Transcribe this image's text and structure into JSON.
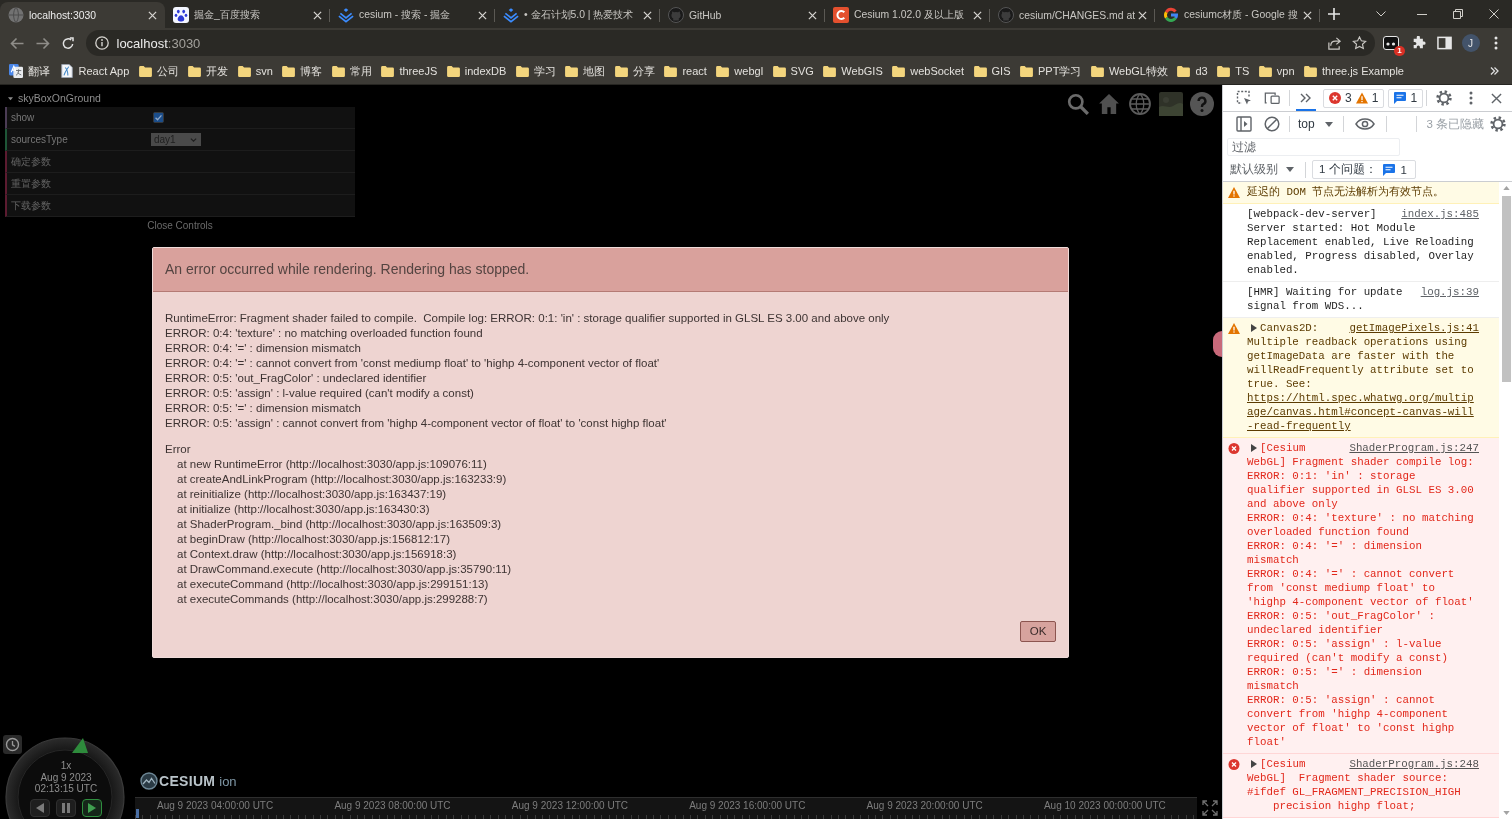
{
  "browser": {
    "tabs": [
      {
        "title": "localhost:3030",
        "kind": "globe",
        "selected": true
      },
      {
        "title": "掘金_百度搜索",
        "kind": "paw",
        "selected": false
      },
      {
        "title": "cesium - 搜索 - 掘金",
        "kind": "chevrons",
        "selected": false
      },
      {
        "title": "• 金石计划5.0 | 热爱技术",
        "kind": "chevrons",
        "selected": false
      },
      {
        "title": "GitHub",
        "kind": "octo",
        "selected": false
      },
      {
        "title": "Cesium 1.02.0 及以上版",
        "kind": "tile",
        "selected": false
      },
      {
        "title": "cesium/CHANGES.md at",
        "kind": "octo",
        "selected": false
      },
      {
        "title": "cesiumc材质 - Google 搜",
        "kind": "ring",
        "selected": false
      }
    ],
    "navigation": {
      "back": {
        "disabled": true
      },
      "forward": {
        "disabled": true
      }
    },
    "address": {
      "host": "localhost",
      "rest": ":3030"
    },
    "extension_badge": "1",
    "profile_initial": "J",
    "bookmarks": [
      {
        "label": "翻译",
        "kind": "translate"
      },
      {
        "label": "React App",
        "kind": "page"
      },
      {
        "label": "公司",
        "kind": "folder"
      },
      {
        "label": "开发",
        "kind": "folder"
      },
      {
        "label": "svn",
        "kind": "folder"
      },
      {
        "label": "博客",
        "kind": "folder"
      },
      {
        "label": "常用",
        "kind": "folder"
      },
      {
        "label": "threeJS",
        "kind": "folder"
      },
      {
        "label": "indexDB",
        "kind": "folder"
      },
      {
        "label": "学习",
        "kind": "folder"
      },
      {
        "label": "地图",
        "kind": "folder"
      },
      {
        "label": "分享",
        "kind": "folder"
      },
      {
        "label": "react",
        "kind": "folder"
      },
      {
        "label": "webgl",
        "kind": "folder"
      },
      {
        "label": "SVG",
        "kind": "folder"
      },
      {
        "label": "WebGIS",
        "kind": "folder"
      },
      {
        "label": "webSocket",
        "kind": "folder"
      },
      {
        "label": "GIS",
        "kind": "folder"
      },
      {
        "label": "PPT学习",
        "kind": "folder"
      },
      {
        "label": "WebGL特效",
        "kind": "folder"
      },
      {
        "label": "d3",
        "kind": "folder"
      },
      {
        "label": "TS",
        "kind": "folder"
      },
      {
        "label": "vpn",
        "kind": "folder"
      },
      {
        "label": "three.js Example",
        "kind": "folder"
      }
    ]
  },
  "viewer": {
    "gui": {
      "title": "skyBoxOnGround",
      "expanded": true,
      "rows": [
        {
          "kind": "boolean",
          "label": "show",
          "checked": true
        },
        {
          "kind": "select",
          "label": "sourcesType",
          "value": "day1"
        },
        {
          "kind": "function",
          "label": "确定参数"
        },
        {
          "kind": "function",
          "label": "重置参数"
        },
        {
          "kind": "function",
          "label": "下载参数"
        }
      ],
      "close_label": "Close Controls"
    },
    "error_dialog": {
      "title": "An error occurred while rendering. Rendering has stopped.",
      "message_lines": [
        "RuntimeError: Fragment shader failed to compile.  Compile log: ERROR: 0:1: 'in' : storage qualifier supported in GLSL ES 3.00 and above only",
        "ERROR: 0:4: 'texture' : no matching overloaded function found",
        "ERROR: 0:4: '=' : dimension mismatch",
        "ERROR: 0:4: '=' : cannot convert from 'const mediump float' to 'highp 4-component vector of float'",
        "ERROR: 0:5: 'out_FragColor' : undeclared identifier",
        "ERROR: 0:5: 'assign' : l-value required (can't modify a const)",
        "ERROR: 0:5: '=' : dimension mismatch",
        "ERROR: 0:5: 'assign' : cannot convert from 'highp 4-component vector of float' to 'const highp float'"
      ],
      "stack_title": "Error",
      "stack_lines": [
        "at new RuntimeError (http://localhost:3030/app.js:109076:11)",
        "at createAndLinkProgram (http://localhost:3030/app.js:163233:9)",
        "at reinitialize (http://localhost:3030/app.js:163437:19)",
        "at initialize (http://localhost:3030/app.js:163430:3)",
        "at ShaderProgram._bind (http://localhost:3030/app.js:163509:3)",
        "at beginDraw (http://localhost:3030/app.js:156812:17)",
        "at Context.draw (http://localhost:3030/app.js:156918:3)",
        "at DrawCommand.execute (http://localhost:3030/app.js:35790:11)",
        "at executeCommand (http://localhost:3030/app.js:299151:13)",
        "at executeCommands (http://localhost:3030/app.js:299288:7)"
      ],
      "button": "OK"
    },
    "clock": {
      "speed": "1x",
      "date": "Aug 9 2023",
      "time": "02:13:15 UTC",
      "buttons": [
        {
          "kind": "reverse",
          "selected": false
        },
        {
          "kind": "pause",
          "selected": false
        },
        {
          "kind": "play",
          "selected": true
        }
      ]
    },
    "logo": {
      "name": "CESIUM",
      "suffix": "ion"
    },
    "timeline": {
      "labels": [
        "Aug 9 2023 04:00:00 UTC",
        "Aug 9 2023 08:00:00 UTC",
        "Aug 9 2023 12:00:00 UTC",
        "Aug 9 2023 16:00:00 UTC",
        "Aug 9 2023 20:00:00 UTC",
        "Aug 10 2023 00:00:00 UTC"
      ]
    }
  },
  "devtools": {
    "error_count": "3",
    "warning_count": "1",
    "info_count": "1",
    "context": "top",
    "hidden": "3 条已隐藏",
    "filter": {
      "placeholder": "过滤"
    },
    "levels": "默认级别",
    "issues": {
      "label": "1 个问题：",
      "count": "1"
    },
    "messages": [
      {
        "kind": "warning",
        "lines": [
          "延迟的 DOM 节点无法解析为有效节点。"
        ]
      },
      {
        "kind": "info",
        "source": "index.js:485",
        "lines": [
          "[webpack-dev-server] Server started: Hot Module Replacement enabled, Live Reloading enabled, Progress disabled, Overlay enabled."
        ]
      },
      {
        "kind": "info",
        "source": "log.js:39",
        "lines": [
          "[HMR] Waiting for update signal from WDS..."
        ]
      },
      {
        "kind": "warning",
        "source": "getImagePixels.js:41",
        "toggle": {
          "expanded": false
        },
        "lines": [
          "Canvas2D: Multiple readback operations using getImageData are faster with the willReadFrequently attribute set to true. See:"
        ],
        "link": "https://html.spec.whatwg.org/multipage/canvas.html#concept-canvas-will-read-frequently"
      },
      {
        "kind": "error",
        "source": "ShaderProgram.js:247",
        "toggle": {
          "expanded": false
        },
        "lines": [
          "[Cesium",
          "WebGL] Fragment shader compile log:",
          "ERROR: 0:1: 'in' : storage qualifier supported in GLSL ES 3.00 and above only",
          "ERROR: 0:4: 'texture' : no matching overloaded function found",
          "ERROR: 0:4: '=' : dimension mismatch",
          "ERROR: 0:4: '=' : cannot convert from 'const mediump float' to 'highp 4-component vector of float'",
          "ERROR: 0:5: 'out_FragColor' : undeclared identifier",
          "ERROR: 0:5: 'assign' : l-value required (can't modify a const)",
          "ERROR: 0:5: '=' : dimension mismatch",
          "ERROR: 0:5: 'assign' : cannot convert from 'highp 4-component vector of float' to 'const highp float'"
        ]
      },
      {
        "kind": "error",
        "source": "ShaderProgram.js:248",
        "toggle": {
          "expanded": false
        },
        "lines": [
          "[Cesium",
          "WebGL]  Fragment shader source:",
          "#ifdef GL_FRAGMENT_PRECISION_HIGH",
          "    precision highp float;"
        ]
      }
    ]
  }
}
